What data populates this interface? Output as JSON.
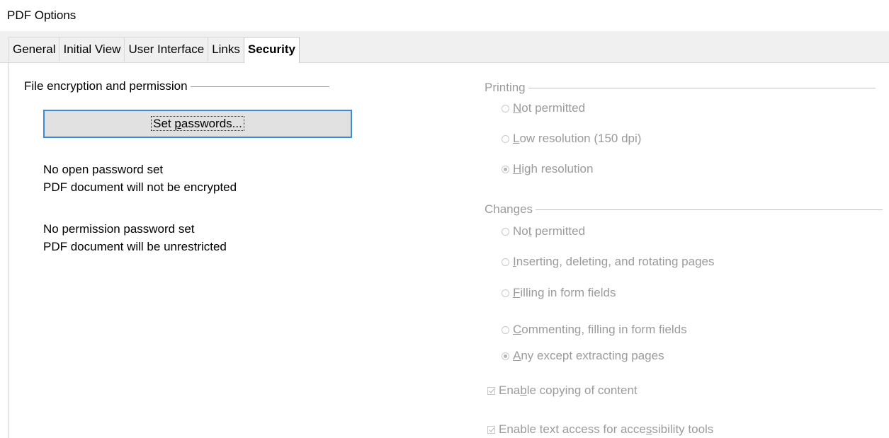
{
  "window": {
    "title": "PDF Options"
  },
  "tabs": [
    {
      "label": "General",
      "active": false
    },
    {
      "label": "Initial View",
      "active": false
    },
    {
      "label": "User Interface",
      "active": false
    },
    {
      "label": "Links",
      "active": false
    },
    {
      "label": "Security",
      "active": true
    }
  ],
  "encryption": {
    "heading": "File encryption and permission",
    "set_passwords_button": {
      "pre": "Set ",
      "accel": "p",
      "post": "asswords..."
    },
    "open_password_status": "No open password set",
    "open_password_detail": "PDF document will not be encrypted",
    "permission_password_status": "No permission password set",
    "permission_password_detail": "PDF document will be unrestricted"
  },
  "printing": {
    "heading": "Printing",
    "options": [
      {
        "pre": "",
        "accel": "N",
        "post": "ot permitted",
        "checked": false
      },
      {
        "pre": "",
        "accel": "L",
        "post": "ow resolution (150 dpi)",
        "checked": false
      },
      {
        "pre": "",
        "accel": "H",
        "post": "igh resolution",
        "checked": true
      }
    ]
  },
  "changes": {
    "heading": "Changes",
    "options": [
      {
        "pre": "No",
        "accel": "t",
        "post": " permitted",
        "checked": false
      },
      {
        "pre": "",
        "accel": "I",
        "post": "nserting, deleting, and rotating pages",
        "checked": false
      },
      {
        "pre": "",
        "accel": "F",
        "post": "illing in form fields",
        "checked": false
      },
      {
        "pre": "",
        "accel": "C",
        "post": "ommenting, filling in form fields",
        "checked": false
      },
      {
        "pre": "",
        "accel": "A",
        "post": "ny except extracting pages",
        "checked": true
      }
    ]
  },
  "content": {
    "copying": {
      "pre": "Ena",
      "accel": "b",
      "post": "le copying of content",
      "checked": true
    },
    "accessibility": {
      "pre": "Enable text access for acce",
      "accel": "s",
      "post": "sibility tools",
      "checked": true
    }
  },
  "colors": {
    "focus_border": "#3c8ad6",
    "disabled_text": "#9b9b9b",
    "tabbar_bg": "#f0f0f0"
  }
}
